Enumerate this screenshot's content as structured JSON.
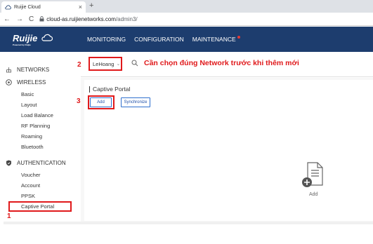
{
  "browser": {
    "tab_title": "Ruijie Cloud",
    "tab_close": "×",
    "new_tab": "+",
    "back": "←",
    "forward": "→",
    "reload": "C",
    "url_host": "cloud-as.ruijienetworks.com",
    "url_path": "/admin3/"
  },
  "header": {
    "logo_text": "Ruijie",
    "logo_sub": "Powered by Ruijie",
    "nav": [
      "MONITORING",
      "CONFIGURATION",
      "MAINTENANCE"
    ],
    "accent": "#1d3d6e",
    "badge_color": "#e53935"
  },
  "sidebar": {
    "networks": "NETWORKS",
    "wireless": "WIRELESS",
    "wireless_items": [
      "Basic",
      "Layout",
      "Load Balance",
      "RF Planning",
      "Roaming",
      "Bluetooth"
    ],
    "authentication": "AUTHENTICATION",
    "auth_items": [
      "Voucher",
      "Account",
      "PPSK",
      "Captive Portal"
    ]
  },
  "network_selector": {
    "value": "LeHoang",
    "annotation": "Cần chọn đúng Network trước khi thêm mới"
  },
  "step_numbers": {
    "one": "1",
    "two": "2",
    "three": "3"
  },
  "panel": {
    "title": "Captive Portal",
    "add_button": "Add",
    "sync_button": "Synchronize",
    "empty_label": "Add"
  },
  "colors": {
    "highlight": "#e0191b",
    "button_border": "#2f6fce"
  }
}
